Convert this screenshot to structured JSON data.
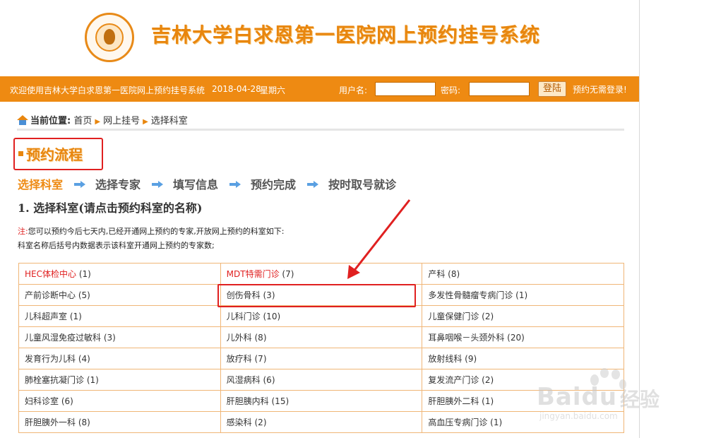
{
  "header": {
    "title": "吉林大学白求恩第一医院网上预约挂号系统"
  },
  "topbar": {
    "welcome": "欢迎使用吉林大学白求恩第一医院网上预约挂号系统",
    "date": "2018-04-28",
    "weekday": "星期六",
    "username_label": "用户名:",
    "username_value": "",
    "password_label": "密码:",
    "password_value": "",
    "login_button": "登陆",
    "no_register": "预约无需登录!"
  },
  "breadcrumb": {
    "label": "当前位置:",
    "items": [
      "首页",
      "网上挂号",
      "选择科室"
    ]
  },
  "flow": {
    "title": "预约流程",
    "steps": [
      "选择科室",
      "选择专家",
      "填写信息",
      "预约完成",
      "按时取号就诊"
    ],
    "active_index": 0
  },
  "section": {
    "heading": "1. 选择科室(请点击预约科室的名称)"
  },
  "note": {
    "label": "注:",
    "line1": "您可以预约今后七天内,已经开通网上预约的专家,开放网上预约的科室如下:",
    "line2": "科室名称后括号内数据表示该科室开通网上预约的专家数;"
  },
  "departments": [
    [
      {
        "name": "HEC体检中心",
        "count": "(1)",
        "red": true
      },
      {
        "name": "MDT特需门诊",
        "count": "(7)",
        "red": true
      },
      {
        "name": "产科",
        "count": "(8)"
      }
    ],
    [
      {
        "name": "产前诊断中心",
        "count": "(5)"
      },
      {
        "name": "创伤骨科",
        "count": "(3)"
      },
      {
        "name": "多发性骨髓瘤专病门诊",
        "count": "(1)"
      }
    ],
    [
      {
        "name": "儿科超声室",
        "count": "(1)"
      },
      {
        "name": "儿科门诊",
        "count": "(10)"
      },
      {
        "name": "儿童保健门诊",
        "count": "(2)"
      }
    ],
    [
      {
        "name": "儿童风湿免疫过敏科",
        "count": "(3)"
      },
      {
        "name": "儿外科",
        "count": "(8)"
      },
      {
        "name": "耳鼻咽喉－头颈外科",
        "count": "(20)"
      }
    ],
    [
      {
        "name": "发育行为儿科",
        "count": "(4)"
      },
      {
        "name": "放疗科",
        "count": "(7)"
      },
      {
        "name": "放射线科",
        "count": "(9)"
      }
    ],
    [
      {
        "name": "肺栓塞抗凝门诊",
        "count": "(1)"
      },
      {
        "name": "风湿病科",
        "count": "(6)"
      },
      {
        "name": "复发流产门诊",
        "count": "(2)"
      }
    ],
    [
      {
        "name": "妇科诊室",
        "count": "(6)"
      },
      {
        "name": "肝胆胰内科",
        "count": "(15)"
      },
      {
        "name": "肝胆胰外二科",
        "count": "(1)"
      }
    ],
    [
      {
        "name": "肝胆胰外一科",
        "count": "(8)"
      },
      {
        "name": "感染科",
        "count": "(2)"
      },
      {
        "name": "高血压专病门诊",
        "count": "(1)"
      }
    ]
  ],
  "watermark": {
    "brand": "Baidu",
    "brand_cn": "经验",
    "url": "jingyan.baidu.com"
  },
  "colors": {
    "accent": "#ee8a12",
    "highlight": "#e02020",
    "link_blue": "#5aa0e2"
  }
}
